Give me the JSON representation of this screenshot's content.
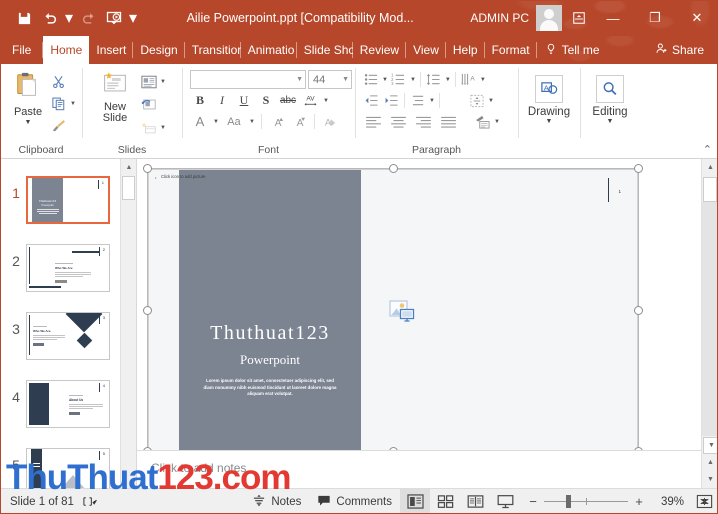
{
  "titlebar": {
    "document_title": "Ailie Powerpoint.ppt [Compatibility Mod...",
    "account_name": "ADMIN PC",
    "qat": [
      {
        "name": "save",
        "label": "Save"
      },
      {
        "name": "undo",
        "label": "Undo"
      },
      {
        "name": "redo",
        "label": "Redo"
      },
      {
        "name": "start-presentation",
        "label": "Start From Beginning"
      },
      {
        "name": "customize-qat",
        "label": "Customize Quick Access Toolbar"
      }
    ],
    "ribbon_display_label": "Ribbon Display Options",
    "minimize_label": "—",
    "maximize_label": "❐",
    "close_label": "✕",
    "accent_color": "#b7472a"
  },
  "tabs": [
    {
      "label": "File",
      "active": false
    },
    {
      "label": "Home",
      "active": true
    },
    {
      "label": "Insert",
      "active": false
    },
    {
      "label": "Design",
      "active": false
    },
    {
      "label": "Transitior",
      "active": false
    },
    {
      "label": "Animatio",
      "active": false
    },
    {
      "label": "Slide Sho",
      "active": false
    },
    {
      "label": "Review",
      "active": false
    },
    {
      "label": "View",
      "active": false
    },
    {
      "label": "Help",
      "active": false
    },
    {
      "label": "Format",
      "active": false
    }
  ],
  "tellme": {
    "label": "Tell me",
    "icon": "lightbulb-icon"
  },
  "share": {
    "label": "Share",
    "icon": "share-person-icon"
  },
  "ribbon": {
    "groups": [
      {
        "name": "clipboard",
        "label": "Clipboard",
        "main_button": {
          "label": "Paste",
          "icon": "paste-icon"
        },
        "small_buttons": [
          {
            "name": "cut",
            "icon": "scissors-icon"
          },
          {
            "name": "copy",
            "icon": "copy-icon"
          },
          {
            "name": "format-painter",
            "icon": "format-painter-icon"
          }
        ]
      },
      {
        "name": "slides",
        "label": "Slides",
        "main_button": {
          "label": "New Slide",
          "icon": "new-slide-icon"
        },
        "small_buttons": [
          {
            "name": "layout",
            "icon": "layout-icon"
          },
          {
            "name": "reset",
            "icon": "reset-icon"
          },
          {
            "name": "section",
            "icon": "section-icon"
          }
        ]
      },
      {
        "name": "font",
        "label": "Font",
        "font_name": {
          "value": "",
          "placeholder": ""
        },
        "font_size": {
          "value": "44"
        },
        "buttons_row1": [
          "B",
          "I",
          "U",
          "S",
          "abc",
          "AV"
        ],
        "buttons_row2": [
          "A",
          "Aa",
          "A↑",
          "A↓",
          "clear-formatting"
        ]
      },
      {
        "name": "paragraph",
        "label": "Paragraph",
        "buttons": [
          "bullets",
          "numbering",
          "decrease-indent",
          "increase-indent",
          "line-spacing",
          "text-direction",
          "align-text",
          "columns",
          "align-left",
          "align-center",
          "align-right",
          "justify",
          "convert-to-smartart"
        ]
      },
      {
        "name": "drawing",
        "label": "Drawing",
        "icon": "drawing-shapes-icon",
        "collapsed": true
      },
      {
        "name": "editing",
        "label": "Editing",
        "icon": "magnifier-icon",
        "collapsed": true
      }
    ],
    "collapse_label": "⌃"
  },
  "thumbnails": {
    "slides": [
      {
        "number": "1",
        "selected": true,
        "style": "title-dark-left"
      },
      {
        "number": "2",
        "selected": false,
        "style": "who-we-are"
      },
      {
        "number": "3",
        "selected": false,
        "style": "diamond"
      },
      {
        "number": "4",
        "selected": false,
        "style": "about-us"
      },
      {
        "number": "5",
        "selected": false,
        "style": "mountain"
      }
    ]
  },
  "slide": {
    "picture_placeholder_text": "Click icon to add picture",
    "title": "Thuthuat123",
    "subtitle": "Powerpoint",
    "body_text": "Lorem ipsum dolor sit amet, consectetuer adipiscing elit, sed diam nonummy nibh euismod tincidunt ut laoreet dolore magna aliquam erat volutpat.",
    "slide_number": "1",
    "picture_icon": "picture-placeholder-icon",
    "band_color": "#7b8490",
    "background_color": "#f5f6f7"
  },
  "notes": {
    "placeholder": "Click to add notes"
  },
  "statusbar": {
    "slide_counter": "Slide 1 of 81",
    "language_icon": "spell-check-icon",
    "notes_label": "Notes",
    "notes_icon": "notes-icon",
    "comments_label": "Comments",
    "comments_icon": "comment-icon",
    "views": [
      {
        "name": "normal-view",
        "icon": "normal-view-icon",
        "active": true
      },
      {
        "name": "slide-sorter-view",
        "icon": "slide-sorter-icon",
        "active": false
      },
      {
        "name": "reading-view",
        "icon": "reading-view-icon",
        "active": false
      },
      {
        "name": "slide-show-view",
        "icon": "slide-show-icon",
        "active": false
      }
    ],
    "zoom_out_label": "−",
    "zoom_in_label": "+",
    "zoom_percent": "39%",
    "fit_label": "Fit slide to current window"
  },
  "watermark": {
    "part1": "ThuThuat",
    "part2": "123.com",
    "color1": "#2f6fd0",
    "color2": "#e23a33"
  }
}
